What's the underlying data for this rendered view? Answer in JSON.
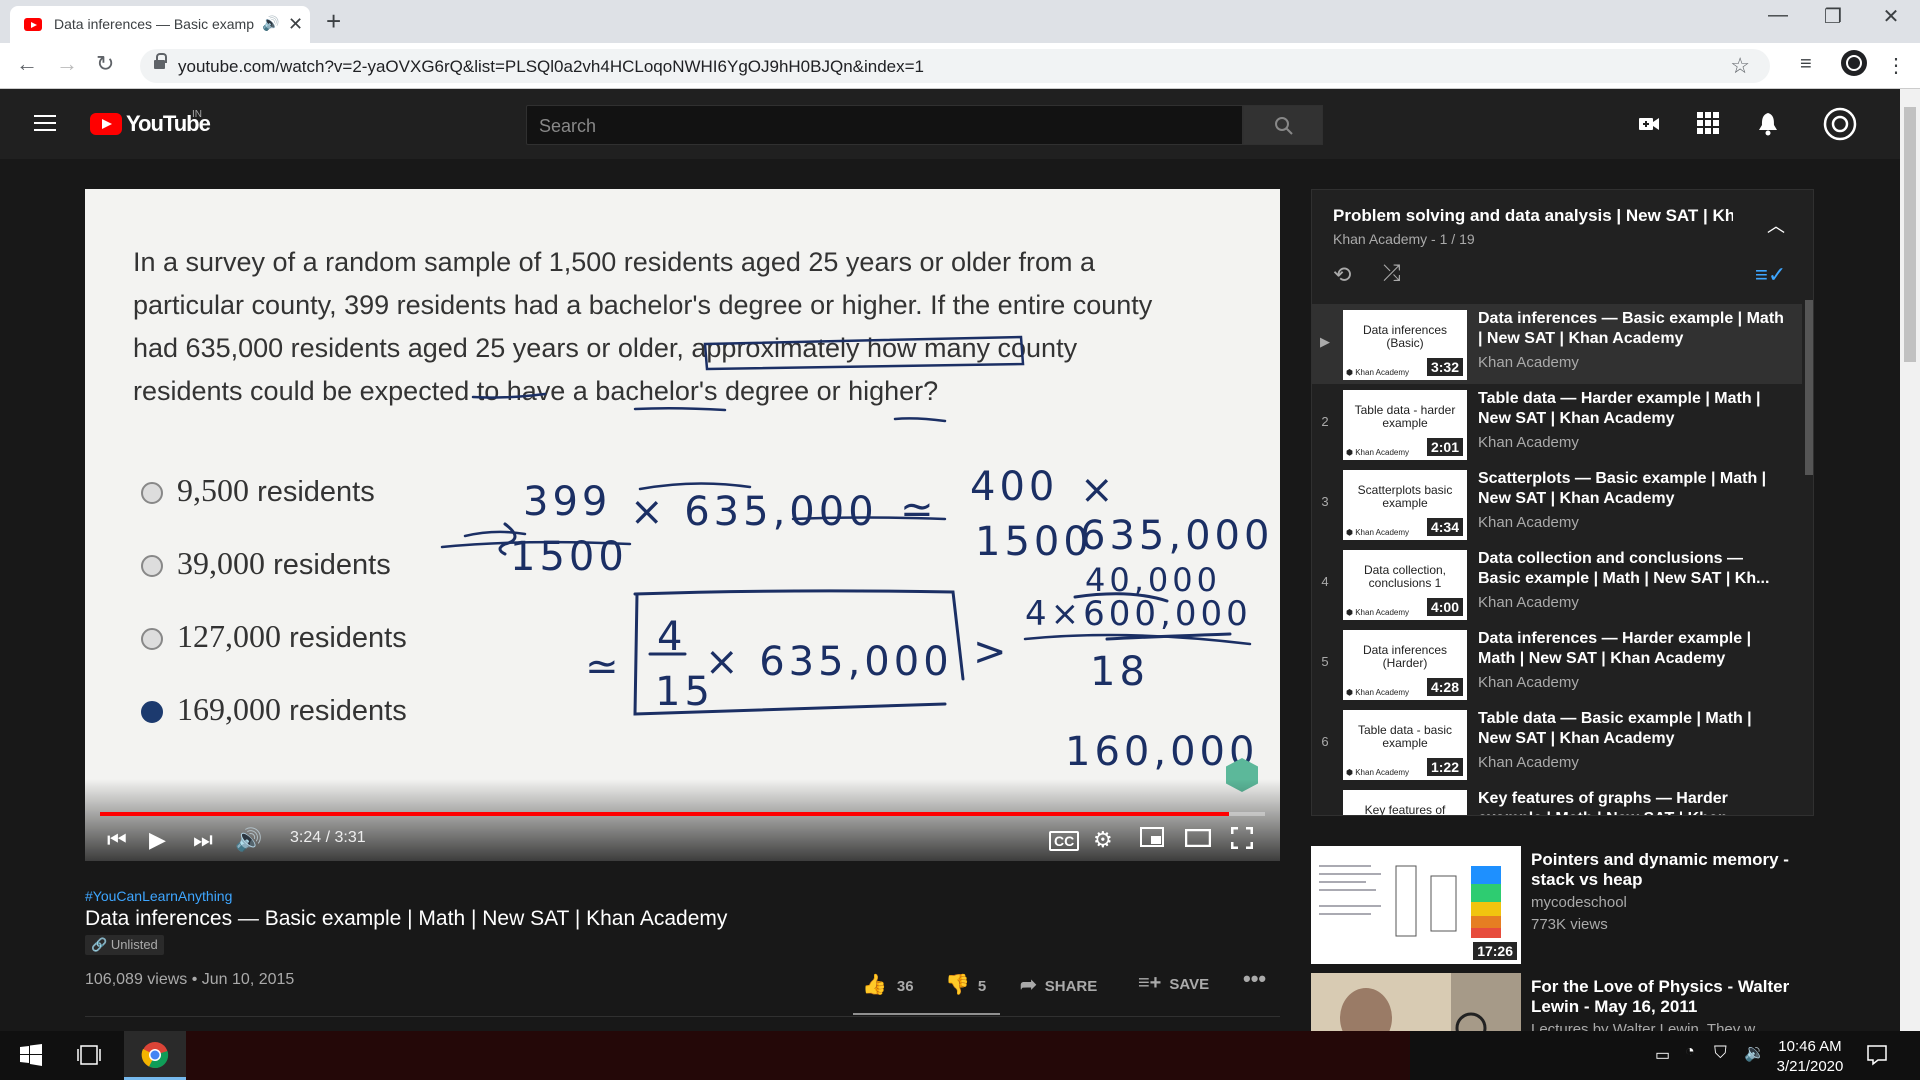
{
  "browser": {
    "tab_title": "Data inferences — Basic example | Math | New SAT | Khan Academy",
    "url": "youtube.com/watch?v=2-yaOVXG6rQ&list=PLSQl0a2vh4HCLoqoNWHI6YgOJ9hH0BJQn&index=1"
  },
  "youtube": {
    "logo_text": "YouTube",
    "country": "IN",
    "search_placeholder": "Search"
  },
  "video": {
    "problem_text": "In a survey of a random sample of 1,500 residents aged 25 years or older from a particular county, 399 residents had a bachelor's degree or higher. If the entire county had 635,000 residents aged 25 years or older, approximately how many county residents could be expected to have a bachelor's degree or higher?",
    "options": [
      {
        "value": "9,500",
        "unit": "residents",
        "selected": false
      },
      {
        "value": "39,000",
        "unit": "residents",
        "selected": false
      },
      {
        "value": "127,000",
        "unit": "residents",
        "selected": false
      },
      {
        "value": "169,000",
        "unit": "residents",
        "selected": true
      }
    ],
    "handwriting": {
      "frac1_num": "399",
      "frac1_den": "1500",
      "times1": "× 635,000",
      "approx": "≃",
      "frac2_num": "400",
      "frac2_den": "1500",
      "times2": "× 635,000",
      "boxed_num": "4",
      "boxed_den": "15",
      "boxed_times": "× 635,000",
      "gt": ">",
      "right_top": "40,000",
      "right_expr": "4×600,000",
      "right_den": "18",
      "result": "160,000"
    },
    "time": "3:24 / 3:31",
    "progress_fraction": 0.969,
    "hashtag": "#YouCanLearnAnything",
    "title": "Data inferences — Basic example | Math | New SAT | Khan Academy",
    "unlisted": "Unlisted",
    "views_date": "106,089 views • Jun 10, 2015",
    "likes": "36",
    "dislikes": "5",
    "share": "SHARE",
    "save": "SAVE"
  },
  "playlist": {
    "title": "Problem solving and data analysis | New SAT | Khan Academy",
    "subtitle": "Khan Academy - 1 / 19",
    "items": [
      {
        "index": "▶",
        "thumb": "Data inferences (Basic)",
        "duration": "3:32",
        "title": "Data inferences — Basic example | Math | New SAT | Khan Academy",
        "channel": "Khan Academy"
      },
      {
        "index": "2",
        "thumb": "Table data - harder example",
        "duration": "2:01",
        "title": "Table data — Harder example | Math | New SAT | Khan Academy",
        "channel": "Khan Academy"
      },
      {
        "index": "3",
        "thumb": "Scatterplots basic example",
        "duration": "4:34",
        "title": "Scatterplots — Basic example | Math | New SAT | Khan Academy",
        "channel": "Khan Academy"
      },
      {
        "index": "4",
        "thumb": "Data collection, conclusions 1",
        "duration": "4:00",
        "title": "Data collection and conclusions — Basic example | Math | New SAT | Kh...",
        "channel": "Khan Academy"
      },
      {
        "index": "5",
        "thumb": "Data inferences (Harder)",
        "duration": "4:28",
        "title": "Data inferences — Harder example | Math | New SAT | Khan Academy",
        "channel": "Khan Academy"
      },
      {
        "index": "6",
        "thumb": "Table data - basic example",
        "duration": "1:22",
        "title": "Table data — Basic example | Math | New SAT | Khan Academy",
        "channel": "Khan Academy"
      },
      {
        "index": "",
        "thumb": "Key features of",
        "duration": "",
        "title": "Key features of graphs — Harder example | Math | New SAT | Khan",
        "channel": ""
      }
    ]
  },
  "related": [
    {
      "title": "Pointers and dynamic memory - stack vs heap",
      "channel": "mycodeschool",
      "views": "773K views",
      "duration": "17:26"
    },
    {
      "title": "For the Love of Physics - Walter Lewin - May 16, 2011",
      "channel": "Lectures by Walter Lewin. They w...",
      "views": "",
      "duration": ""
    }
  ],
  "taskbar": {
    "time": "10:46 AM",
    "date": "3/21/2020"
  },
  "colors": {
    "youtube_red": "#ff0000",
    "ink_blue": "#1b2f64",
    "link_blue": "#3ea6ff"
  }
}
